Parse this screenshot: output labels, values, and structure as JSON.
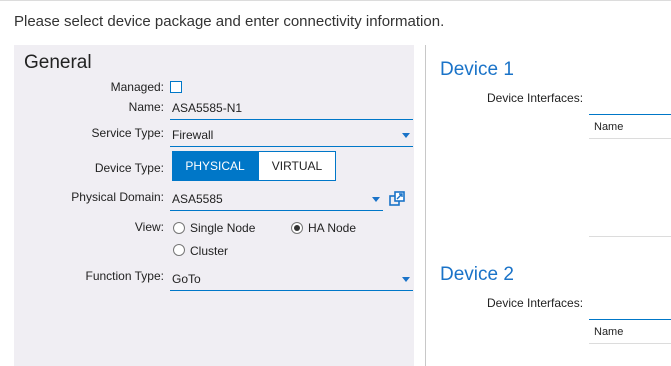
{
  "header": {
    "instruction": "Please select device package and enter connectivity information."
  },
  "general": {
    "title": "General",
    "managed": {
      "label": "Managed:",
      "checked": false
    },
    "name": {
      "label": "Name:",
      "value": "ASA5585-N1"
    },
    "service_type": {
      "label": "Service Type:",
      "value": "Firewall"
    },
    "device_type": {
      "label": "Device Type:",
      "options": [
        "PHYSICAL",
        "VIRTUAL"
      ],
      "selected": "PHYSICAL"
    },
    "physical_domain": {
      "label": "Physical Domain:",
      "value": "ASA5585"
    },
    "view": {
      "label": "View:",
      "options": [
        "Single Node",
        "HA Node",
        "Cluster"
      ],
      "selected": "HA Node"
    },
    "function_type": {
      "label": "Function Type:",
      "value": "GoTo"
    }
  },
  "devices": [
    {
      "title": "Device 1",
      "interfaces_label": "Device Interfaces:",
      "column": "Name"
    },
    {
      "title": "Device 2",
      "interfaces_label": "Device Interfaces:",
      "column": "Name"
    }
  ],
  "colors": {
    "accent": "#0077c8",
    "panel_bg": "#f0eef3",
    "title_blue": "#1a73c8"
  }
}
